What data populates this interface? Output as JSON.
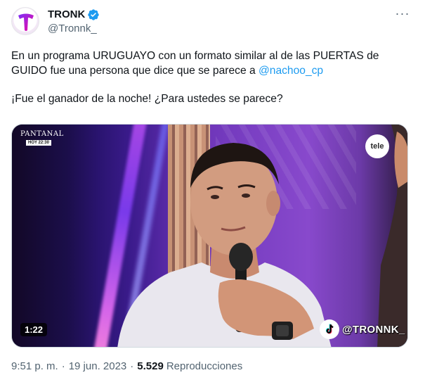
{
  "author": {
    "display_name": "TRONK",
    "handle": "@Tronnk_",
    "avatar_letter": "T",
    "verified": true,
    "verified_color": "#1d9bf0"
  },
  "more_label": "···",
  "tweet": {
    "para1_text": "En un programa URUGUAYO con un formato similar al de las PUERTAS de GUIDO fue una persona que dice que se parece a ",
    "para1_mention": "@nachoo_cp",
    "para2_text": "¡Fue el ganador de la noche! ¿Para ustedes se parece?"
  },
  "media": {
    "channel_logo": "PANTANAL",
    "channel_time": "HOY 22:30",
    "network_logo": "tele",
    "duration": "1:22",
    "watermark": "@TRONNK_"
  },
  "meta": {
    "time": "9:51 p. m.",
    "separator": "·",
    "date": "19 jun. 2023",
    "views_count": "5.529",
    "views_label": "Reproducciones"
  },
  "colors": {
    "accent": "#1d9bf0",
    "text_primary": "#0f1419",
    "text_secondary": "#536471",
    "avatar_gradient": [
      "#7b2ff7",
      "#f107a3"
    ]
  }
}
